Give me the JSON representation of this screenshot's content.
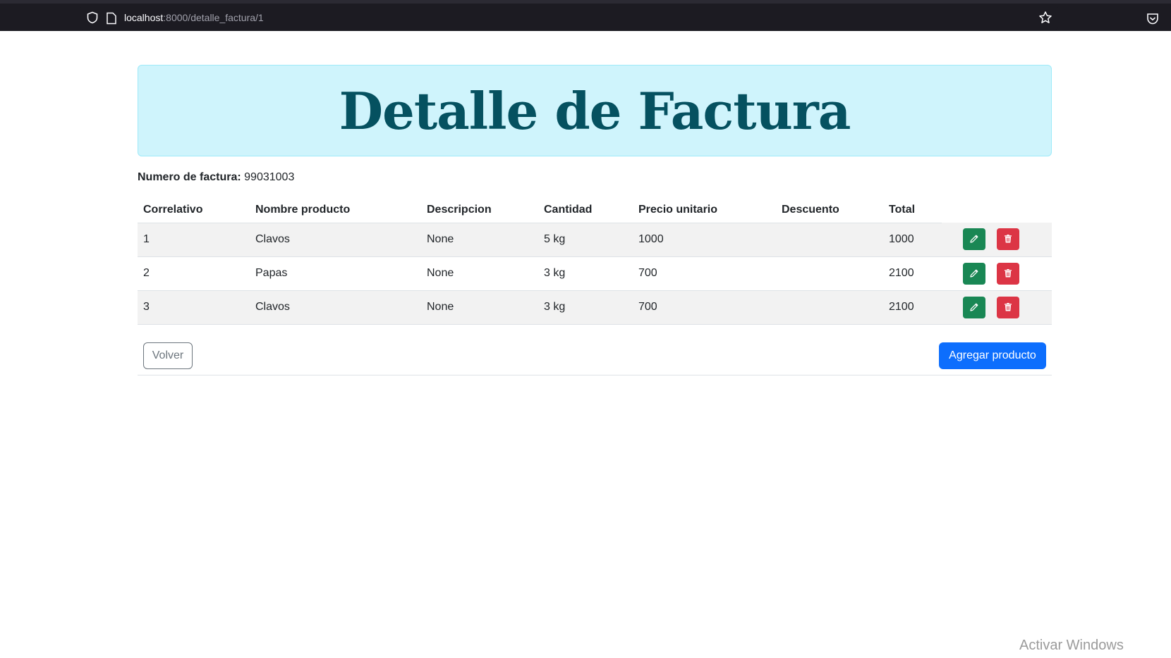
{
  "browser": {
    "url_host": "localhost",
    "url_path": ":8000/detalle_factura/1"
  },
  "page": {
    "title": "Detalle de Factura",
    "invoice_label": "Numero de factura:",
    "invoice_number": "99031003"
  },
  "table": {
    "headers": [
      "Correlativo",
      "Nombre producto",
      "Descripcion",
      "Cantidad",
      "Precio unitario",
      "Descuento",
      "Total"
    ],
    "rows": [
      [
        "1",
        "Clavos",
        "None",
        "5 kg",
        "1000",
        "",
        "1000"
      ],
      [
        "2",
        "Papas",
        "None",
        "3 kg",
        "700",
        "",
        "2100"
      ],
      [
        "3",
        "Clavos",
        "None",
        "3 kg",
        "700",
        "",
        "2100"
      ]
    ]
  },
  "buttons": {
    "back": "Volver",
    "add": "Agregar producto"
  },
  "colors": {
    "banner_bg": "#cff4fc",
    "banner_text": "#055160",
    "edit": "#198754",
    "delete": "#dc3545",
    "primary": "#0d6efd"
  },
  "watermark": "Activar Windows"
}
